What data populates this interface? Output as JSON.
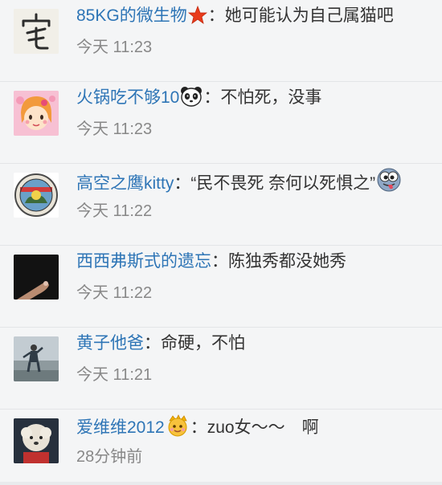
{
  "comments": [
    {
      "user": "85KG的微生物",
      "separator": "：",
      "text": "她可能认为自己属猫吧",
      "time": "今天 11:23",
      "avatar_icon": "zhai-character-avatar",
      "badge_icon": "red-star-icon"
    },
    {
      "user": "火锅吃不够10",
      "separator": "：",
      "text": "不怕死，没事",
      "time": "今天 11:23",
      "avatar_icon": "cartoon-girl-avatar",
      "badge_icon": "panda-emoji-icon"
    },
    {
      "user": "高空之鹰kitty",
      "separator": "：",
      "text": "“民不畏死 奈何以死惧之”",
      "time": "今天 11:22",
      "avatar_icon": "badge-avatar",
      "badge_icon": "tongue-face-emoji-icon"
    },
    {
      "user": "西西弗斯式的遗忘",
      "separator": "：",
      "text": "陈独秀都没她秀",
      "time": "今天 11:22",
      "avatar_icon": "dark-photo-avatar",
      "badge_icon": ""
    },
    {
      "user": "黄子他爸",
      "separator": "：",
      "text": "命硬，不怕",
      "time": "今天 11:21",
      "avatar_icon": "beach-child-avatar",
      "badge_icon": ""
    },
    {
      "user": "爱维维2012",
      "separator": "：",
      "text": "zuo女～～　啊",
      "time": "28分钟前",
      "avatar_icon": "poodle-avatar",
      "badge_icon": "crown-emoji-icon"
    }
  ],
  "colors": {
    "username": "#2e75b6",
    "text": "#333333",
    "time": "#888888",
    "background": "#f4f5f6"
  }
}
